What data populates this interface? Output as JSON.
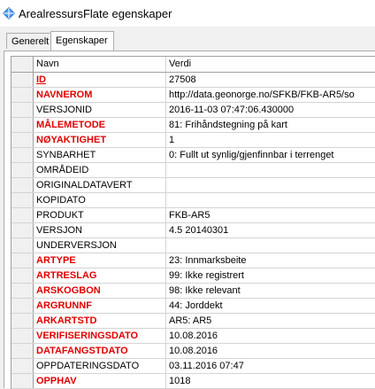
{
  "window": {
    "title": "ArealressursFlate egenskaper"
  },
  "tabs": [
    {
      "label": "Generelt"
    },
    {
      "label": "Egenskaper"
    }
  ],
  "grid": {
    "headers": {
      "name": "Navn",
      "value": "Verdi"
    },
    "rows": [
      {
        "name": "ID",
        "value": "27508"
      },
      {
        "name": "NAVNEROM",
        "value": "http://data.geonorge.no/SFKB/FKB-AR5/so"
      },
      {
        "name": "VERSJONID",
        "value": "2016-11-03 07:47:06.430000"
      },
      {
        "name": "MÅLEMETODE",
        "value": "81: Frihåndstegning på kart"
      },
      {
        "name": "NØYAKTIGHET",
        "value": "1"
      },
      {
        "name": "SYNBARHET",
        "value": "0: Fullt ut synlig/gjenfinnbar i terrenget"
      },
      {
        "name": "OMRÅDEID",
        "value": ""
      },
      {
        "name": "ORIGINALDATAVERT",
        "value": ""
      },
      {
        "name": "KOPIDATO",
        "value": ""
      },
      {
        "name": "PRODUKT",
        "value": "FKB-AR5"
      },
      {
        "name": "VERSJON",
        "value": "4.5 20140301"
      },
      {
        "name": "UNDERVERSJON",
        "value": ""
      },
      {
        "name": "ARTYPE",
        "value": "23: Innmarksbeite"
      },
      {
        "name": "ARTRESLAG",
        "value": "99: Ikke registrert"
      },
      {
        "name": "ARSKOGBON",
        "value": "98: Ikke relevant"
      },
      {
        "name": "ARGRUNNF",
        "value": "44: Jorddekt"
      },
      {
        "name": "ARKARTSTD",
        "value": "AR5: AR5"
      },
      {
        "name": "VERIFISERINGSDATO",
        "value": "10.08.2016"
      },
      {
        "name": "DATAFANGSTDATO",
        "value": "10.08.2016"
      },
      {
        "name": "OPPDATERINGSDATO",
        "value": "03.11.2016 07:47"
      },
      {
        "name": "OPPHAV",
        "value": "1018"
      }
    ]
  }
}
